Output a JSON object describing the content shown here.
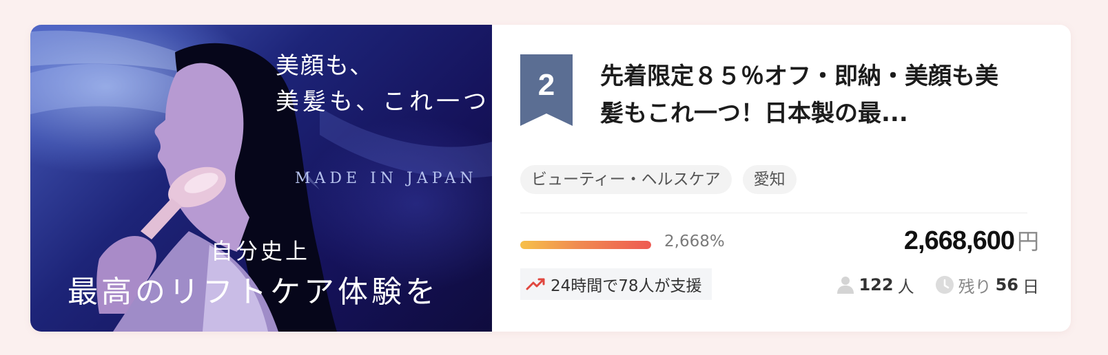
{
  "hero": {
    "line1": "美顔も、",
    "line2": "美髪も、これ一つ",
    "made_in": "MADE IN JAPAN",
    "line4": "自分史上",
    "line5": "最高のリフトケア体験を"
  },
  "rank": {
    "number": "2",
    "color": "#5b6e93"
  },
  "project": {
    "title": "先着限定８５％オフ・即納・美顔も美髪もこれ一つ！日本製の最...",
    "tags": [
      "ビューティー・ヘルスケア",
      "愛知"
    ],
    "progress_percent_text": "2,668%",
    "progress_fill_fraction": 1.0,
    "amount": "2,668,600",
    "currency": "円",
    "trend_text": "24時間で78人が支援",
    "supporters": "122",
    "supporters_unit": "人",
    "remaining_label": "残り",
    "remaining_days": "56",
    "remaining_unit": "日"
  },
  "icons": {
    "trend": "trending-up-icon",
    "person": "person-icon",
    "clock": "clock-icon"
  },
  "colors": {
    "accent_trend": "#e0473f",
    "progress_start": "#f6c04a",
    "progress_end": "#ee5a52"
  }
}
